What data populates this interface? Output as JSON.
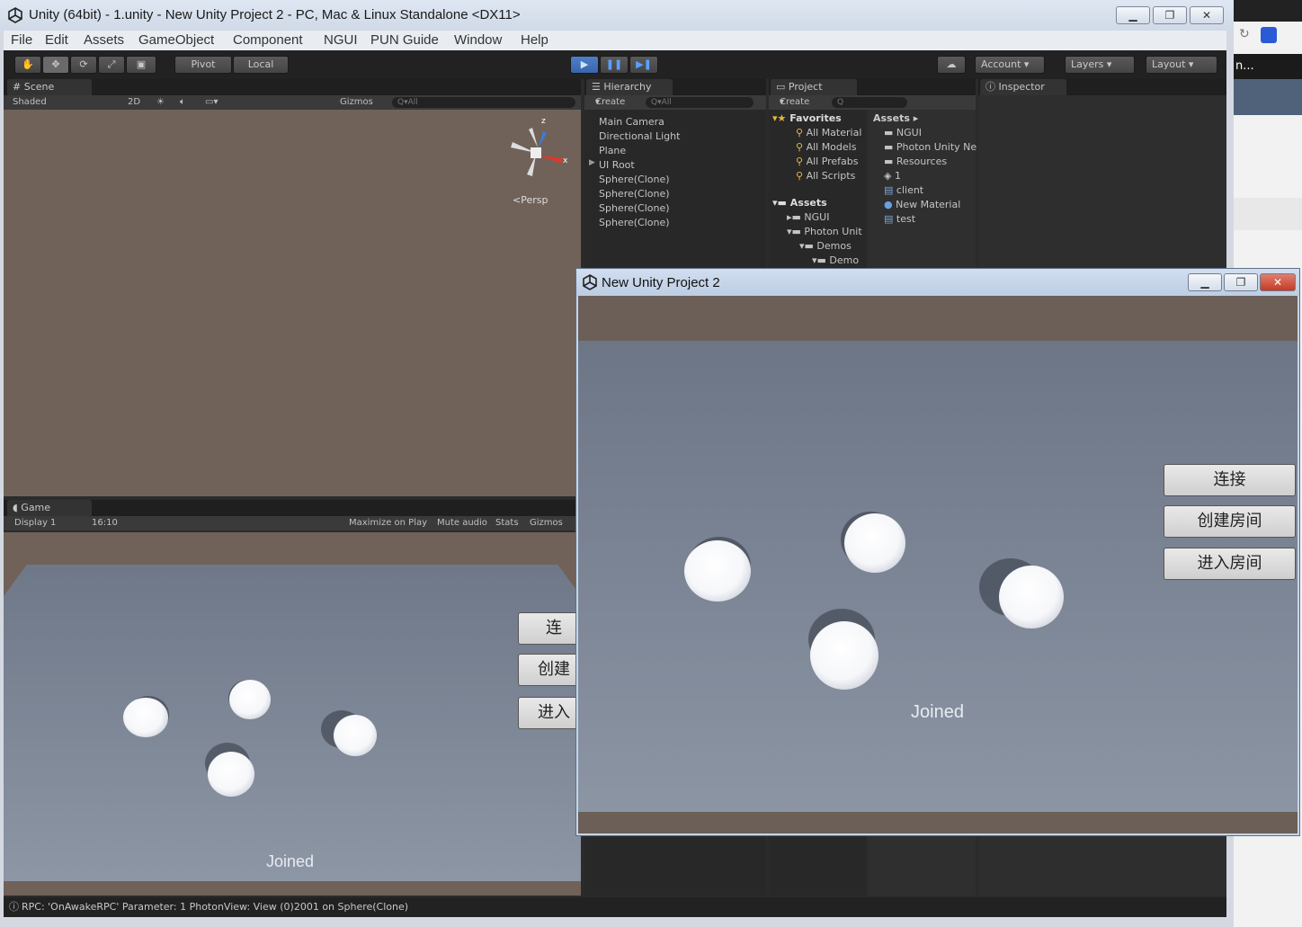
{
  "window": {
    "title": "Unity (64bit) - 1.unity - New Unity Project 2 - PC, Mac & Linux Standalone <DX11>",
    "minimize": "▁",
    "maximize": "❐",
    "close": "✕"
  },
  "menu": [
    "File",
    "Edit",
    "Assets",
    "GameObject",
    "Component",
    "NGUI",
    "PUN Guide",
    "Window",
    "Help"
  ],
  "toolbar": {
    "pivot": "Pivot",
    "local": "Local",
    "account": "Account",
    "layers": "Layers",
    "layout": "Layout"
  },
  "scene": {
    "tab": "Scene",
    "shaded": "Shaded",
    "mode2d": "2D",
    "gizmos": "Gizmos",
    "search": "Q▾All",
    "persp": "<Persp",
    "axis_z": "z",
    "axis_x": "x"
  },
  "game": {
    "tab": "Game",
    "display": "Display 1",
    "aspect": "16:10",
    "maximize": "Maximize on Play",
    "mute": "Mute audio",
    "stats": "Stats",
    "gizmos": "Gizmos",
    "btn1": "连",
    "btn2": "创建",
    "btn3": "进入",
    "joined": "Joined"
  },
  "hierarchy": {
    "tab": "Hierarchy",
    "create": "Create",
    "search": "Q▾All",
    "items": [
      "Main Camera",
      "Directional Light",
      "Plane",
      "UI Root",
      "Sphere(Clone)",
      "Sphere(Clone)",
      "Sphere(Clone)",
      "Sphere(Clone)"
    ]
  },
  "project": {
    "tab": "Project",
    "create": "Create",
    "favorites": "Favorites",
    "fav_items": [
      "All Material",
      "All Models",
      "All Prefabs",
      "All Scripts"
    ],
    "assets_title": "Assets",
    "tree": [
      "NGUI",
      "Photon Unit",
      "Demos",
      "Demo"
    ],
    "assets_crumb": "Assets ▸",
    "asset_items": [
      "NGUI",
      "Photon Unity Ne",
      "Resources",
      "1",
      "client",
      "New Material",
      "test"
    ]
  },
  "inspector": {
    "tab": "Inspector"
  },
  "popup": {
    "title": "New Unity Project 2",
    "buttons": [
      "连接",
      "创建房间",
      "进入房间"
    ],
    "joined": "Joined"
  },
  "status": "RPC: 'OnAwakeRPC' Parameter: 1 PhotonView: View (0)2001 on Sphere(Clone)",
  "sidebar": {
    "text": "n..."
  }
}
